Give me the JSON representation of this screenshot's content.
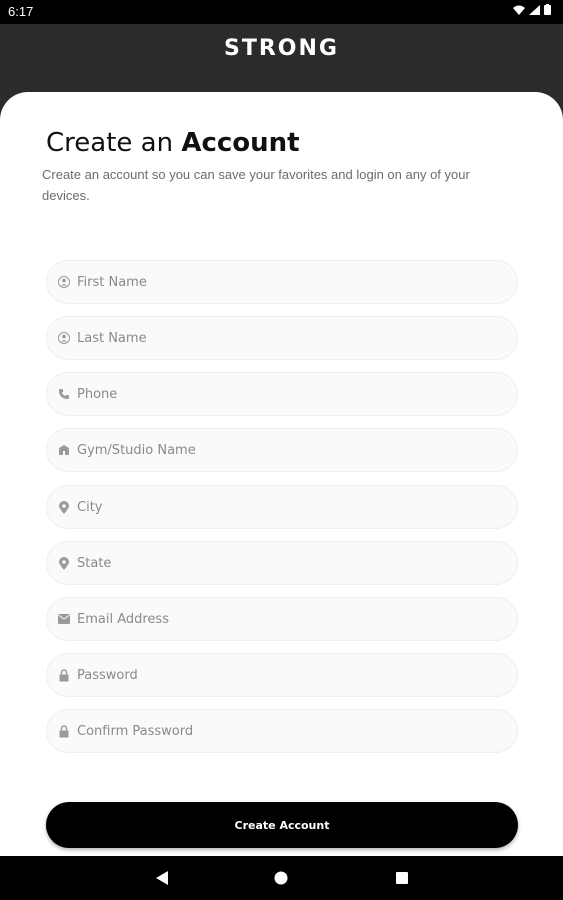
{
  "status": {
    "time": "6:17"
  },
  "app": {
    "logo": "STRONG"
  },
  "form": {
    "title_prefix": "Create an",
    "title_bold": "Account",
    "subtitle": "Create an account so you can save your favorites and login on any of your devices.",
    "fields": [
      {
        "placeholder": "First Name",
        "icon": "person-icon"
      },
      {
        "placeholder": "Last Name",
        "icon": "person-icon"
      },
      {
        "placeholder": "Phone",
        "icon": "phone-icon"
      },
      {
        "placeholder": "Gym/Studio Name",
        "icon": "building-icon"
      },
      {
        "placeholder": "City",
        "icon": "location-pin-icon"
      },
      {
        "placeholder": "State",
        "icon": "location-pin-icon"
      },
      {
        "placeholder": "Email Address",
        "icon": "email-icon"
      },
      {
        "placeholder": "Password",
        "icon": "lock-icon"
      },
      {
        "placeholder": "Confirm Password",
        "icon": "lock-icon"
      }
    ],
    "submit_label": "Create Account"
  },
  "colors": {
    "header_bg": "#2a2b2d",
    "button_bg": "#000000",
    "field_bg": "#fafafa"
  }
}
